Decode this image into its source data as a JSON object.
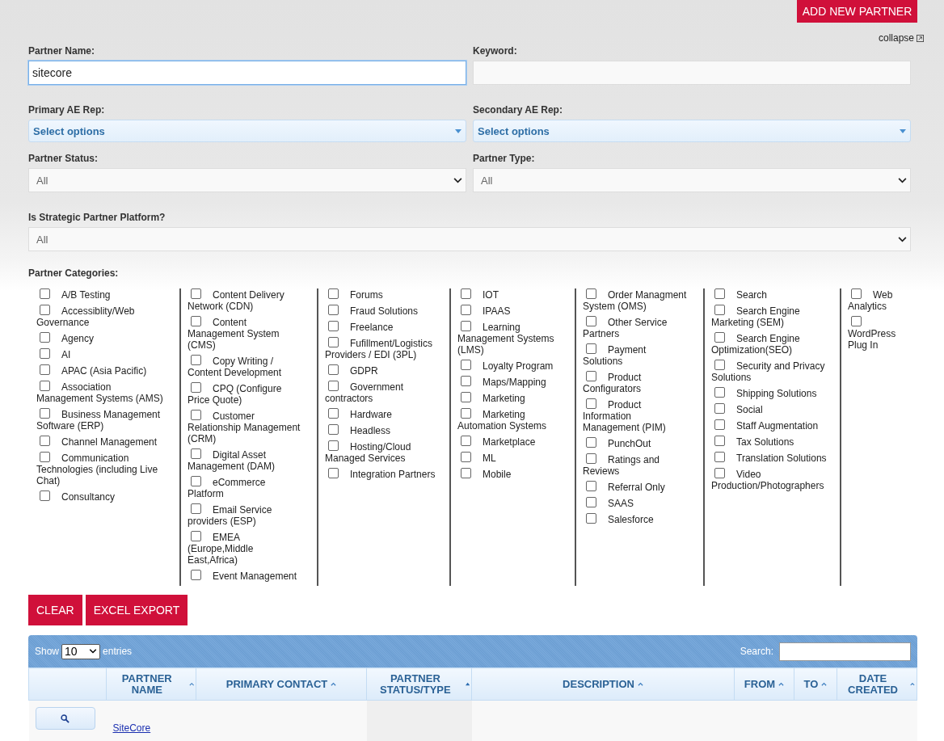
{
  "add_button": "ADD NEW PARTNER",
  "collapse": {
    "label": "collapse"
  },
  "fields": [
    {
      "kind": "text",
      "label": "Partner Name:",
      "value": "sitecore",
      "focused": true
    },
    {
      "kind": "text",
      "label": "Keyword:",
      "focused": false
    },
    {
      "kind": "multi",
      "label": "Primary AE Rep:",
      "value": "Select options"
    },
    {
      "kind": "multi",
      "label": "Secondary AE Rep:",
      "value": "Select options"
    },
    {
      "kind": "select",
      "label": "Partner Status:",
      "value": "All"
    },
    {
      "kind": "select",
      "label": "Partner Type:",
      "value": "All"
    },
    {
      "kind": "select",
      "label": "Is Strategic Partner Platform?",
      "value": "All",
      "wide": true
    }
  ],
  "categories": {
    "label": "Partner Categories:",
    "columns": [
      [
        {
          "label": "A/B Testing",
          "checked": false
        },
        {
          "label": "Accessiblity/Web Governance",
          "checked": false
        },
        {
          "label": "Agency",
          "checked": false
        },
        {
          "label": "AI",
          "checked": false
        },
        {
          "label": "APAC (Asia Pacific)",
          "checked": false
        },
        {
          "label": "Association Management Systems (AMS)",
          "checked": false
        },
        {
          "label": "Business Management Software (ERP)",
          "checked": false
        },
        {
          "label": "Channel Management",
          "checked": false
        },
        {
          "label": "Communication Technologies (including Live Chat)",
          "checked": false
        },
        {
          "label": "Consultancy",
          "checked": false
        }
      ],
      [
        {
          "label": "Content Delivery Network (CDN)",
          "checked": false
        },
        {
          "label": "Content Management System (CMS)",
          "checked": false
        },
        {
          "label": "Copy Writing / Content Development",
          "checked": false
        },
        {
          "label": "CPQ (Configure Price Quote)",
          "checked": false
        },
        {
          "label": "Customer Relationship Management (CRM)",
          "checked": false
        },
        {
          "label": "Digital Asset Management (DAM)",
          "checked": false
        },
        {
          "label": "eCommerce Platform",
          "checked": false
        },
        {
          "label": "Email Service providers (ESP)",
          "checked": false
        },
        {
          "label": "EMEA (Europe,Middle East,Africa)",
          "checked": false
        },
        {
          "label": "Event Management",
          "checked": false
        }
      ],
      [
        {
          "label": "Forums",
          "checked": false
        },
        {
          "label": "Fraud Solutions",
          "checked": false
        },
        {
          "label": "Freelance",
          "checked": false
        },
        {
          "label": "Fufillment/Logistics Providers / EDI (3PL)",
          "checked": false
        },
        {
          "label": "GDPR",
          "checked": false
        },
        {
          "label": "Government contractors",
          "checked": false
        },
        {
          "label": "Hardware",
          "checked": false
        },
        {
          "label": "Headless",
          "checked": false
        },
        {
          "label": "Hosting/Cloud Managed Services",
          "checked": false
        },
        {
          "label": "Integration Partners",
          "checked": false
        }
      ],
      [
        {
          "label": "IOT",
          "checked": false
        },
        {
          "label": "IPAAS",
          "checked": false
        },
        {
          "label": "Learning Management Systems (LMS)",
          "checked": false
        },
        {
          "label": "Loyalty Program",
          "checked": false
        },
        {
          "label": "Maps/Mapping",
          "checked": false
        },
        {
          "label": "Marketing",
          "checked": false
        },
        {
          "label": "Marketing Automation Systems",
          "checked": false
        },
        {
          "label": "Marketplace",
          "checked": false
        },
        {
          "label": "ML",
          "checked": false
        },
        {
          "label": "Mobile",
          "checked": false
        }
      ],
      [
        {
          "label": "Order Managment System (OMS)",
          "checked": false
        },
        {
          "label": "Other Service Partners",
          "checked": false
        },
        {
          "label": "Payment Solutions",
          "checked": false
        },
        {
          "label": "Product Configurators",
          "checked": false
        },
        {
          "label": "Product Information Management (PIM)",
          "checked": false
        },
        {
          "label": "PunchOut",
          "checked": false
        },
        {
          "label": "Ratings and Reviews",
          "checked": false
        },
        {
          "label": "Referral Only",
          "checked": false
        },
        {
          "label": "SAAS",
          "checked": false
        },
        {
          "label": "Salesforce",
          "checked": false
        }
      ],
      [
        {
          "label": "Search",
          "checked": false
        },
        {
          "label": "Search Engine Marketing (SEM)",
          "checked": false
        },
        {
          "label": "Search Engine Optimization(SEO)",
          "checked": false
        },
        {
          "label": "Security and Privacy Solutions",
          "checked": false
        },
        {
          "label": "Shipping Solutions",
          "checked": false
        },
        {
          "label": "Social",
          "checked": false
        },
        {
          "label": "Staff Augmentation",
          "checked": false
        },
        {
          "label": "Tax Solutions",
          "checked": false
        },
        {
          "label": "Translation Solutions",
          "checked": false
        },
        {
          "label": "Video Production/Photographers",
          "checked": false
        }
      ],
      [
        {
          "label": "Web Analytics",
          "checked": false
        },
        {
          "label": "WordPress Plug In",
          "checked": false
        }
      ]
    ]
  },
  "actions": [
    "CLEAR",
    "EXCEL EXPORT"
  ],
  "table": {
    "show_label": "Show",
    "page_size": "10",
    "entries_label": "entries",
    "search_label": "Search:",
    "columns": [
      {
        "kind": "blank"
      },
      {
        "kind": "sort",
        "label": "PARTNER NAME",
        "sorted": false
      },
      {
        "kind": "sort",
        "label": "PRIMARY CONTACT",
        "sorted": false
      },
      {
        "kind": "sort",
        "label": "PARTNER STATUS/TYPE",
        "sorted": true
      },
      {
        "kind": "sort",
        "label": "DESCRIPTION",
        "sorted": false
      },
      {
        "kind": "sort",
        "label": "FROM",
        "sorted": false
      },
      {
        "kind": "sort",
        "label": "TO",
        "sorted": false
      },
      {
        "kind": "sort",
        "label": "DATE CREATED",
        "sorted": false
      }
    ],
    "rows": [
      {
        "name": "SiteCore"
      }
    ]
  }
}
